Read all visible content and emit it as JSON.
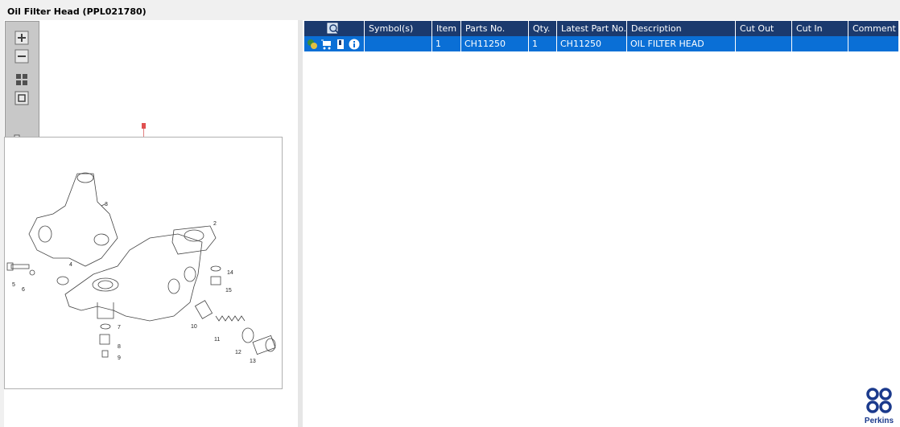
{
  "page": {
    "title": "Oil Filter Head (PPL021780)"
  },
  "toolbar": {
    "zoom_in": "zoom-in-icon",
    "zoom_out": "zoom-out-icon",
    "fit_all": "fit-all-icon",
    "actual_size": "actual-size-icon",
    "expand": "expand-panel-icon"
  },
  "drawing": {
    "callouts": [
      "1",
      "2",
      "3",
      "4",
      "5",
      "6",
      "7",
      "8",
      "9",
      "10",
      "11",
      "12",
      "13",
      "14",
      "15"
    ]
  },
  "table": {
    "headers": [
      "",
      "Symbol(s)",
      "Item",
      "Parts No.",
      "Qty.",
      "Latest Part No.",
      "Description",
      "Cut Out",
      "Cut In",
      "Comment"
    ],
    "rows": [
      {
        "symbols": "",
        "item": "1",
        "parts_no": "CH11250",
        "qty": "1",
        "latest_part_no": "CH11250",
        "description": "OIL FILTER HEAD",
        "cut_out": "",
        "cut_in": "",
        "comment": ""
      }
    ]
  },
  "brand": {
    "name": "Perkins",
    "color": "#1b3a8c"
  },
  "colors": {
    "header_bg": "#1b3a6e",
    "row_selected": "#0a6fd6"
  }
}
